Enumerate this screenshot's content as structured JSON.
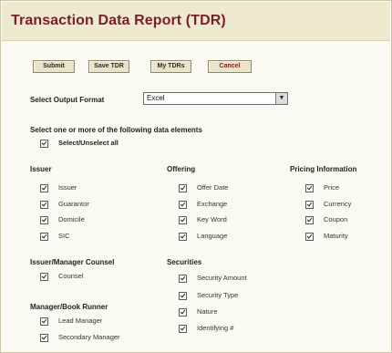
{
  "title": "Transaction Data Report (TDR)",
  "buttons": {
    "submit": "Submit",
    "save_tdr": "Save TDR",
    "my_tdrs": "My TDRs",
    "cancel": "Cancel"
  },
  "output_format": {
    "label": "Select Output Format",
    "value": "Excel"
  },
  "data_elements_label": "Select one or more of the following data elements",
  "select_all_label": "Select/Unselect all",
  "groups": {
    "issuer": {
      "title": "Issuer",
      "items": [
        "Issuer",
        "Guarantor",
        "Domicile",
        "SIC"
      ]
    },
    "offering": {
      "title": "Offering",
      "items": [
        "Offer Date",
        "Exchange",
        "Key Word",
        "Language"
      ]
    },
    "pricing": {
      "title": "Pricing Information",
      "items": [
        "Price",
        "Currency",
        "Coupon",
        "Maturity"
      ]
    },
    "counsel": {
      "title": "Issuer/Manager Counsel",
      "items": [
        "Counsel"
      ]
    },
    "securities": {
      "title": "Securities",
      "items": [
        "Security Amount",
        "Security Type",
        "Nature",
        "Identifying #"
      ]
    },
    "manager": {
      "title": "Manager/Book Runner",
      "items": [
        "Lead Manager",
        "Secondary Manager"
      ]
    }
  }
}
